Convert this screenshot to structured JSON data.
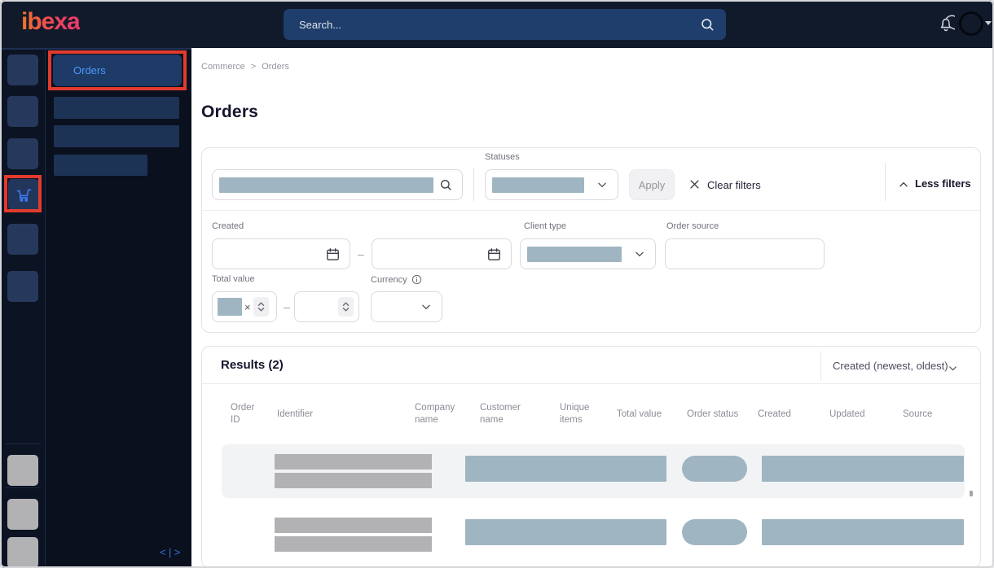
{
  "topbar": {
    "logo_text": "ibexa",
    "search_placeholder": "Search..."
  },
  "nav": {
    "orders_label": "Orders",
    "collapse_glyph": "<|>"
  },
  "breadcrumb": {
    "items": [
      "Commerce",
      "Orders"
    ],
    "separator": ">"
  },
  "page": {
    "title": "Orders"
  },
  "filters": {
    "statuses_label": "Statuses",
    "apply_label": "Apply",
    "clear_filters_label": "Clear filters",
    "less_filters_label": "Less filters",
    "created_label": "Created",
    "client_type_label": "Client type",
    "order_source_label": "Order source",
    "total_value_label": "Total value",
    "currency_label": "Currency",
    "range_separator": "–",
    "clear_value_glyph": "×"
  },
  "results": {
    "title": "Results (2)",
    "sort_value": "Created (newest, oldest)",
    "columns": [
      "Order ID",
      "Identifier",
      "Company name",
      "Customer name",
      "Unique items",
      "Total value",
      "Order status",
      "Created",
      "Updated",
      "Source"
    ]
  },
  "colors": {
    "annotation_red": "#e23b2e",
    "accent_blue": "#4b9bfd",
    "placeholder_blue_gray": "#9fb5c2",
    "placeholder_gray": "#b2b2b5"
  }
}
